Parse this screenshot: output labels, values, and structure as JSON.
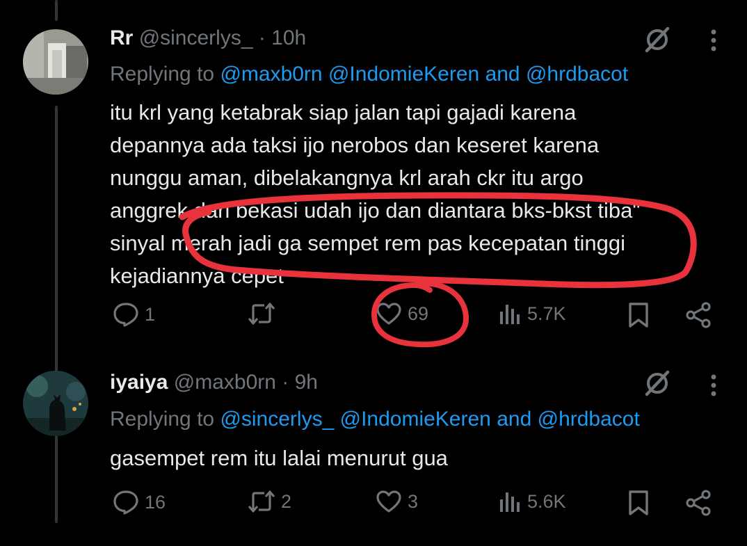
{
  "post1": {
    "name": "Rr",
    "handle": "@sincerlys_",
    "time": "· 10h",
    "replying_prefix": "Replying to",
    "mention1": "@maxb0rn",
    "mention2": "@IndomieKeren",
    "conj": "and",
    "mention3": "@hrdbacot",
    "text": "itu krl yang ketabrak siap jalan tapi gajadi karena\ndepannya ada taksi ijo nerobos dan keseret karena\nnunggu aman, dibelakangnya krl arah ckr itu argo\nanggrek dari bekasi udah ijo dan diantara bks-bkst tiba\"\nsinyal merah jadi ga sempet rem pas kecepatan tinggi\nkejadiannya cepet",
    "replies": "1",
    "reposts": "",
    "likes": "69",
    "views": "5.7K"
  },
  "post2": {
    "name": "iyaiya",
    "handle": "@maxb0rn",
    "time": "· 9h",
    "replying_prefix": "Replying to",
    "mention1": "@sincerlys_",
    "mention2": "@IndomieKeren",
    "conj": "and",
    "mention3": "@hrdbacot",
    "text": "gasempet rem itu lalai menurut gua",
    "replies": "16",
    "reposts": "2",
    "likes": "3",
    "views": "5.6K"
  },
  "icons": {
    "reply": "reply-icon",
    "repost": "repost-icon",
    "like": "heart-icon",
    "views": "views-icon",
    "bookmark": "bookmark-icon",
    "share": "share-icon",
    "grok": "grok-icon",
    "more": "more-icon"
  },
  "colors": {
    "background": "#000000",
    "text": "#e7e9ea",
    "secondary": "#71767b",
    "link": "#1d9bf0",
    "annotation": "#e8323c"
  }
}
